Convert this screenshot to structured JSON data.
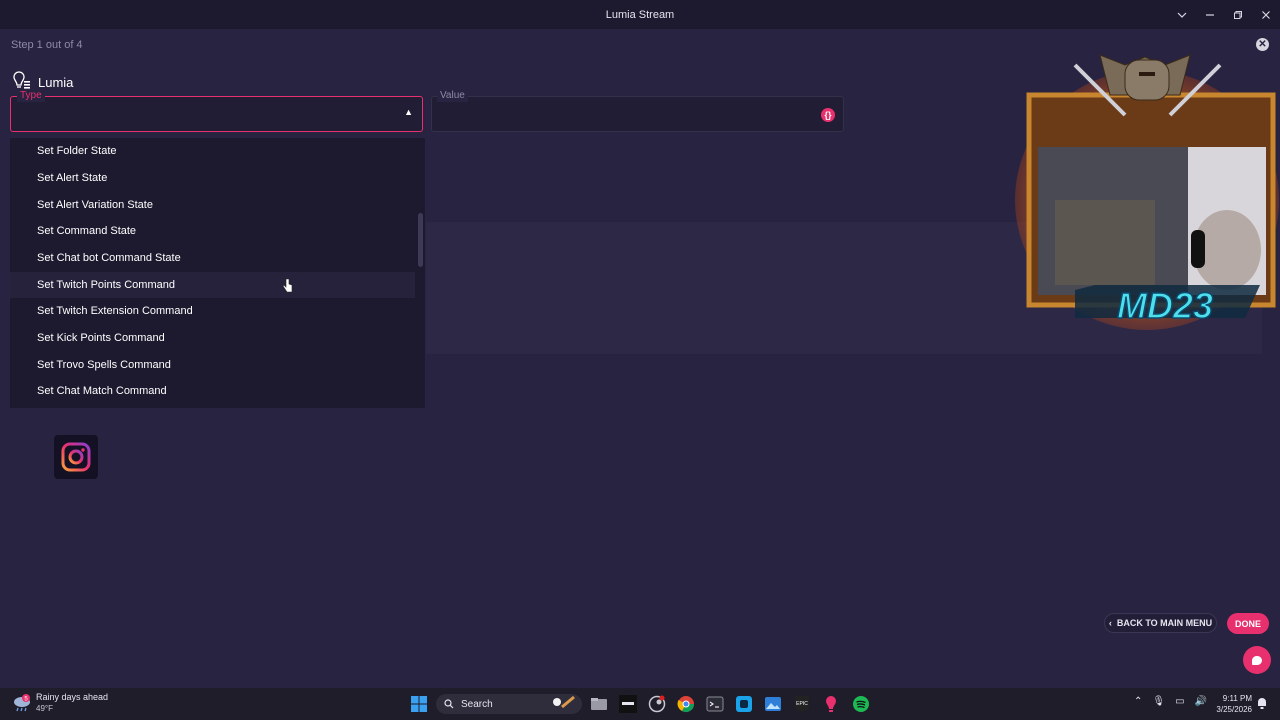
{
  "window": {
    "title": "Lumia Stream",
    "controls": [
      "chevron-down",
      "minimize",
      "restore",
      "close"
    ]
  },
  "step": {
    "text": "Step 1 out of 4"
  },
  "section": {
    "label": "Lumia",
    "icon": "lumia-bulb-icon"
  },
  "type_field": {
    "label": "Type",
    "value": "",
    "icon": "caret-up-icon"
  },
  "value_field": {
    "label": "Value",
    "value": "",
    "icon": "info-icon"
  },
  "dropdown": {
    "options": [
      "Set Folder State",
      "Set Alert State",
      "Set Alert Variation State",
      "Set Command State",
      "Set Chat bot Command State",
      "Set Twitch Points Command",
      "Set Twitch Extension Command",
      "Set Kick Points Command",
      "Set Trovo Spells Command",
      "Set Chat Match Command"
    ],
    "hovered_option": "Set Twitch Points Command"
  },
  "webcam": {
    "overlay_text": "MD23"
  },
  "footer": {
    "back_label": "BACK TO MAIN MENU",
    "done_label": "DONE"
  },
  "colors": {
    "accent": "#e8306e",
    "background": "#272340",
    "panel": "#1d1a2f"
  },
  "taskbar": {
    "weather_title": "Rainy days ahead",
    "weather_temp": "49°F",
    "weather_badge": "5",
    "search_placeholder": "Search",
    "time": "9:11 PM",
    "date": "3/25/2026"
  }
}
